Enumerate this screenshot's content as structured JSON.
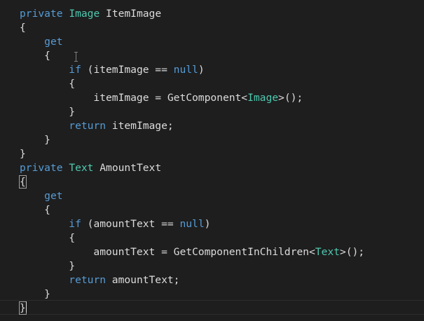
{
  "editor": {
    "lines": [
      [
        {
          "t": "private",
          "c": "kw"
        },
        {
          "t": " ",
          "c": "pl"
        },
        {
          "t": "Image",
          "c": "ty"
        },
        {
          "t": " ItemImage",
          "c": "pl"
        }
      ],
      [
        {
          "t": "{",
          "c": "pl"
        }
      ],
      [
        {
          "t": "    ",
          "c": "pl"
        },
        {
          "t": "get",
          "c": "kw"
        }
      ],
      [
        {
          "t": "    {",
          "c": "pl"
        }
      ],
      [
        {
          "t": "        ",
          "c": "pl"
        },
        {
          "t": "if",
          "c": "kw"
        },
        {
          "t": " (itemImage == ",
          "c": "pl"
        },
        {
          "t": "null",
          "c": "kw"
        },
        {
          "t": ")",
          "c": "pl"
        }
      ],
      [
        {
          "t": "        {",
          "c": "pl"
        }
      ],
      [
        {
          "t": "            itemImage = GetComponent<",
          "c": "pl"
        },
        {
          "t": "Image",
          "c": "ty"
        },
        {
          "t": ">();",
          "c": "pl"
        }
      ],
      [
        {
          "t": "        }",
          "c": "pl"
        }
      ],
      [
        {
          "t": "        ",
          "c": "pl"
        },
        {
          "t": "return",
          "c": "kw"
        },
        {
          "t": " itemImage;",
          "c": "pl"
        }
      ],
      [
        {
          "t": "    }",
          "c": "pl"
        }
      ],
      [
        {
          "t": "}",
          "c": "pl"
        }
      ],
      [
        {
          "t": "private",
          "c": "kw"
        },
        {
          "t": " ",
          "c": "pl"
        },
        {
          "t": "Text",
          "c": "ty"
        },
        {
          "t": " AmountText",
          "c": "pl"
        }
      ],
      [
        {
          "t": "{",
          "c": "pl hl-brace"
        }
      ],
      [
        {
          "t": "    ",
          "c": "pl"
        },
        {
          "t": "get",
          "c": "kw"
        }
      ],
      [
        {
          "t": "    {",
          "c": "pl"
        }
      ],
      [
        {
          "t": "        ",
          "c": "pl"
        },
        {
          "t": "if",
          "c": "kw"
        },
        {
          "t": " (amountText == ",
          "c": "pl"
        },
        {
          "t": "null",
          "c": "kw"
        },
        {
          "t": ")",
          "c": "pl"
        }
      ],
      [
        {
          "t": "        {",
          "c": "pl"
        }
      ],
      [
        {
          "t": "            amountText = GetComponentInChildren<",
          "c": "pl"
        },
        {
          "t": "Text",
          "c": "ty"
        },
        {
          "t": ">();",
          "c": "pl"
        }
      ],
      [
        {
          "t": "        }",
          "c": "pl"
        }
      ],
      [
        {
          "t": "        ",
          "c": "pl"
        },
        {
          "t": "return",
          "c": "kw"
        },
        {
          "t": " amountText;",
          "c": "pl"
        }
      ],
      [
        {
          "t": "    }",
          "c": "pl"
        }
      ],
      [
        {
          "t": "}",
          "c": "pl hl-brace"
        }
      ]
    ]
  },
  "colors": {
    "background": "#1e1e1e",
    "keyword": "#569cd6",
    "type": "#4ec9b0",
    "plain": "#dcdcdc"
  },
  "icons": {
    "mouse_cursor": "i-beam-cursor-icon",
    "text_caret": "text-caret"
  }
}
